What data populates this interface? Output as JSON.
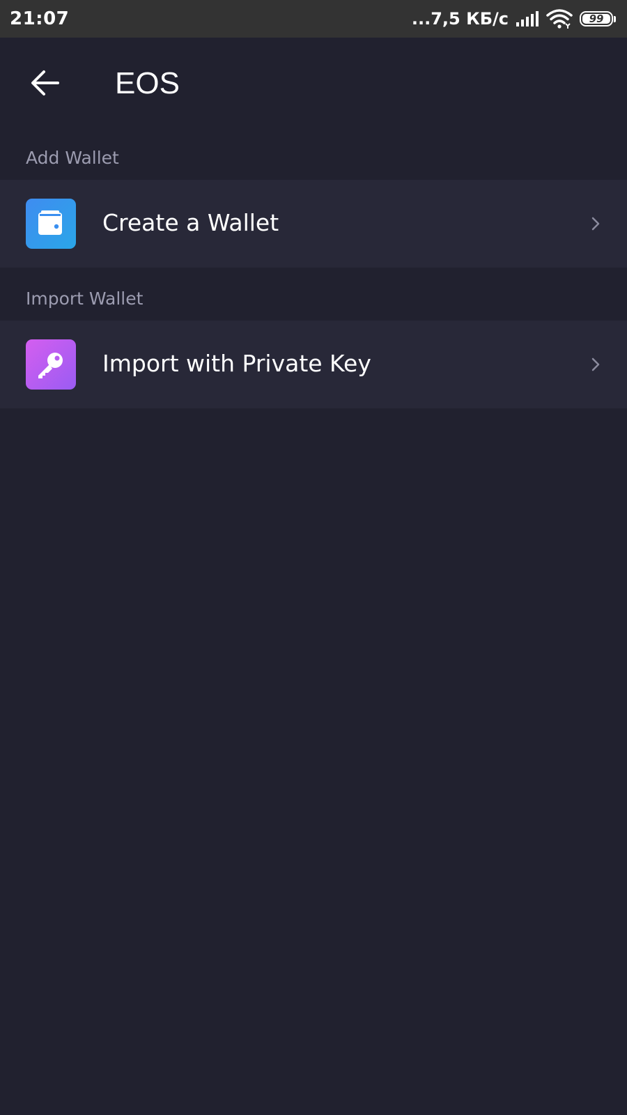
{
  "status_bar": {
    "time": "21:07",
    "speed": "...7,5 КБ/с",
    "battery_level": "99",
    "battery_fraction": 0.99,
    "icons": [
      "signal-icon",
      "wifi-icon",
      "battery-icon"
    ]
  },
  "header": {
    "title": "EOS",
    "back_icon": "arrow-left-icon"
  },
  "sections": {
    "add": {
      "label": "Add Wallet",
      "items": [
        {
          "label": "Create a Wallet",
          "icon": "wallet-icon",
          "icon_color": "#3f8cf0"
        }
      ]
    },
    "import": {
      "label": "Import Wallet",
      "items": [
        {
          "label": "Import with Private Key",
          "icon": "key-icon",
          "icon_color": "#c45ff0"
        }
      ]
    }
  },
  "colors": {
    "background": "#21212f",
    "list_item": "#282838",
    "section_text": "#9c9cb0",
    "status_bar": "#333333"
  }
}
